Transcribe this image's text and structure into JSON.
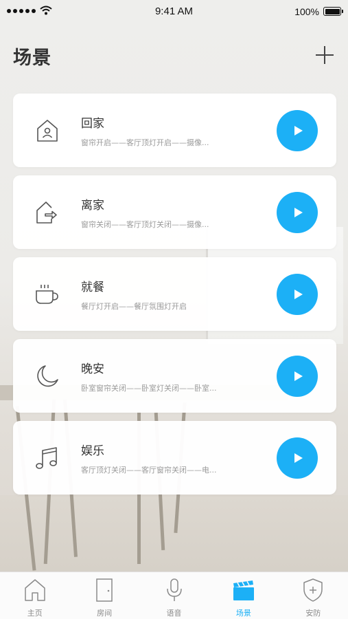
{
  "status_bar": {
    "time": "9:41 AM",
    "battery": "100%"
  },
  "header": {
    "title": "场景",
    "add_icon": "plus-icon"
  },
  "scenes": [
    {
      "name": "回家",
      "desc": "窗帘开启——客厅顶灯开启——摄像...",
      "icon": "home-icon"
    },
    {
      "name": "离家",
      "desc": "窗帘关闭——客厅顶灯关闭——摄像...",
      "icon": "leave-home-icon"
    },
    {
      "name": "就餐",
      "desc": "餐厅灯开启——餐厅氛围灯开启",
      "icon": "cup-icon"
    },
    {
      "name": "晚安",
      "desc": "卧室窗帘关闭——卧室灯关闭——卧室...",
      "icon": "moon-icon"
    },
    {
      "name": "娱乐",
      "desc": "客厅顶灯关闭——客厅窗帘关闭——电...",
      "icon": "music-note-icon"
    }
  ],
  "tabs": [
    {
      "label": "主页",
      "icon": "home-icon"
    },
    {
      "label": "房间",
      "icon": "door-icon"
    },
    {
      "label": "语音",
      "icon": "microphone-icon"
    },
    {
      "label": "场景",
      "icon": "clapperboard-icon",
      "active": true
    },
    {
      "label": "安防",
      "icon": "shield-icon"
    }
  ],
  "colors": {
    "accent": "#1cb0f6",
    "title": "#333333",
    "muted": "#9a9a9a"
  }
}
